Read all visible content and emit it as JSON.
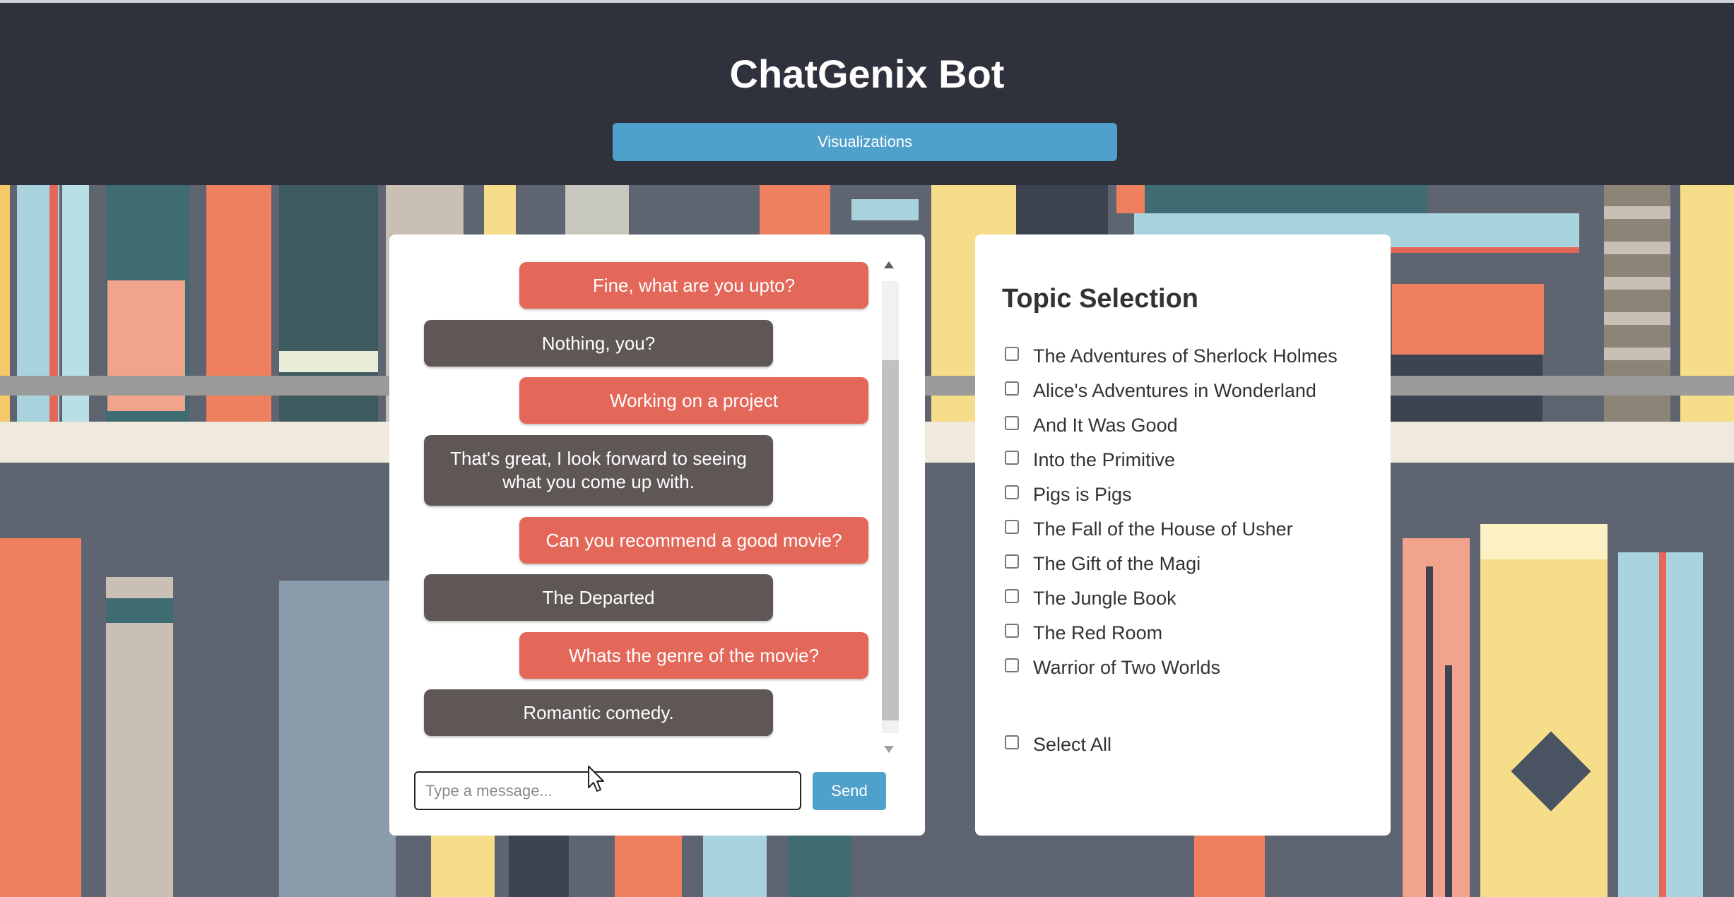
{
  "app": {
    "title": "ChatGenix Bot",
    "visualizations_label": "Visualizations"
  },
  "chat": {
    "messages": [
      {
        "role": "user",
        "text": "Fine, what are you upto?"
      },
      {
        "role": "bot",
        "text": "Nothing, you?"
      },
      {
        "role": "user",
        "text": "Working on a project"
      },
      {
        "role": "bot",
        "text": "That's great, I look forward to seeing what you come up with."
      },
      {
        "role": "user",
        "text": "Can you recommend a good movie?"
      },
      {
        "role": "bot",
        "text": "The Departed"
      },
      {
        "role": "user",
        "text": "Whats the genre of the movie?"
      },
      {
        "role": "bot",
        "text": "Romantic comedy."
      }
    ],
    "input_placeholder": "Type a message...",
    "input_value": "",
    "send_label": "Send"
  },
  "topics": {
    "title": "Topic Selection",
    "items": [
      {
        "label": "The Adventures of Sherlock Holmes",
        "checked": false
      },
      {
        "label": "Alice's Adventures in Wonderland",
        "checked": false
      },
      {
        "label": "And It Was Good",
        "checked": false
      },
      {
        "label": "Into the Primitive",
        "checked": false
      },
      {
        "label": "Pigs is Pigs",
        "checked": false
      },
      {
        "label": "The Fall of the House of Usher",
        "checked": false
      },
      {
        "label": "The Gift of the Magi",
        "checked": false
      },
      {
        "label": "The Jungle Book",
        "checked": false
      },
      {
        "label": "The Red Room",
        "checked": false
      },
      {
        "label": "Warrior of Two Worlds",
        "checked": false
      }
    ],
    "select_all_label": "Select All"
  },
  "colors": {
    "header_bg": "#2f323d",
    "accent_blue": "#4fa0cb",
    "user_bubble": "#e3685a",
    "bot_bubble": "#5e5756",
    "background": "#5f6471"
  },
  "icons": {
    "scroll_up": "scroll-up-arrow-icon",
    "scroll_down": "scroll-down-arrow-icon",
    "cursor": "mouse-pointer-icon",
    "checkbox": "checkbox-icon"
  }
}
